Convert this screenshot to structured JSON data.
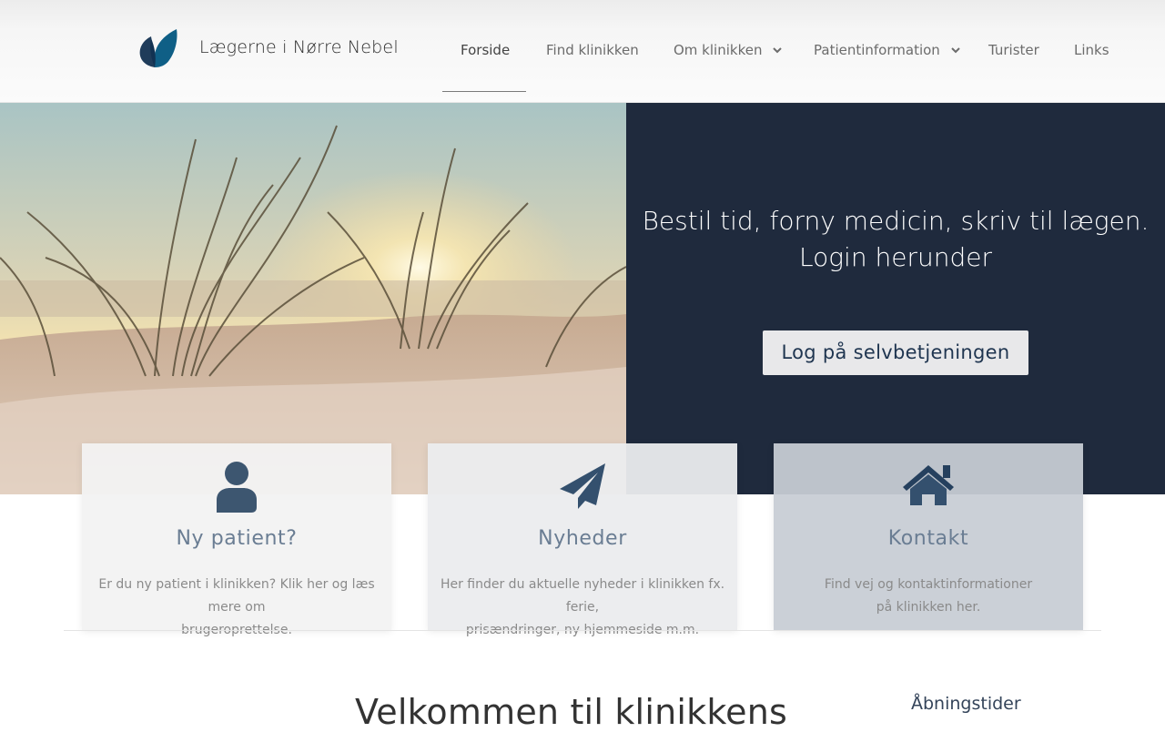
{
  "header": {
    "brand": "Lægerne i Nørre Nebel",
    "nav": [
      {
        "label": "Forside",
        "active": true
      },
      {
        "label": "Find klinikken"
      },
      {
        "label": "Om klinikken",
        "dropdown": true
      },
      {
        "label": "Patientinformation",
        "dropdown": true
      },
      {
        "label": "Turister"
      },
      {
        "label": "Links"
      }
    ]
  },
  "hero": {
    "line1": "Bestil tid, forny medicin, skriv til lægen.",
    "line2": "Login herunder",
    "button": "Log på selvbetjeningen",
    "dark_color": "#1f2a3d"
  },
  "cards": [
    {
      "icon": "user-icon",
      "title": "Ny patient?",
      "text1": "Er du ny patient i klinikken? Klik her og læs mere om",
      "text2": "brugeroprettelse."
    },
    {
      "icon": "paper-plane-icon",
      "title": "Nyheder",
      "text1": "Her finder du aktuelle nyheder i klinikken fx. ferie,",
      "text2": "prisændringer, ny hjemmeside m.m."
    },
    {
      "icon": "home-icon",
      "title": "Kontakt",
      "text1": "Find vej og kontaktinformationer",
      "text2": "på klinikken her."
    }
  ],
  "main": {
    "welcome": "Velkommen til klinikkens",
    "hours_title": "Åbningstider"
  },
  "colors": {
    "accent": "#34506e",
    "icon": "#34506e"
  }
}
